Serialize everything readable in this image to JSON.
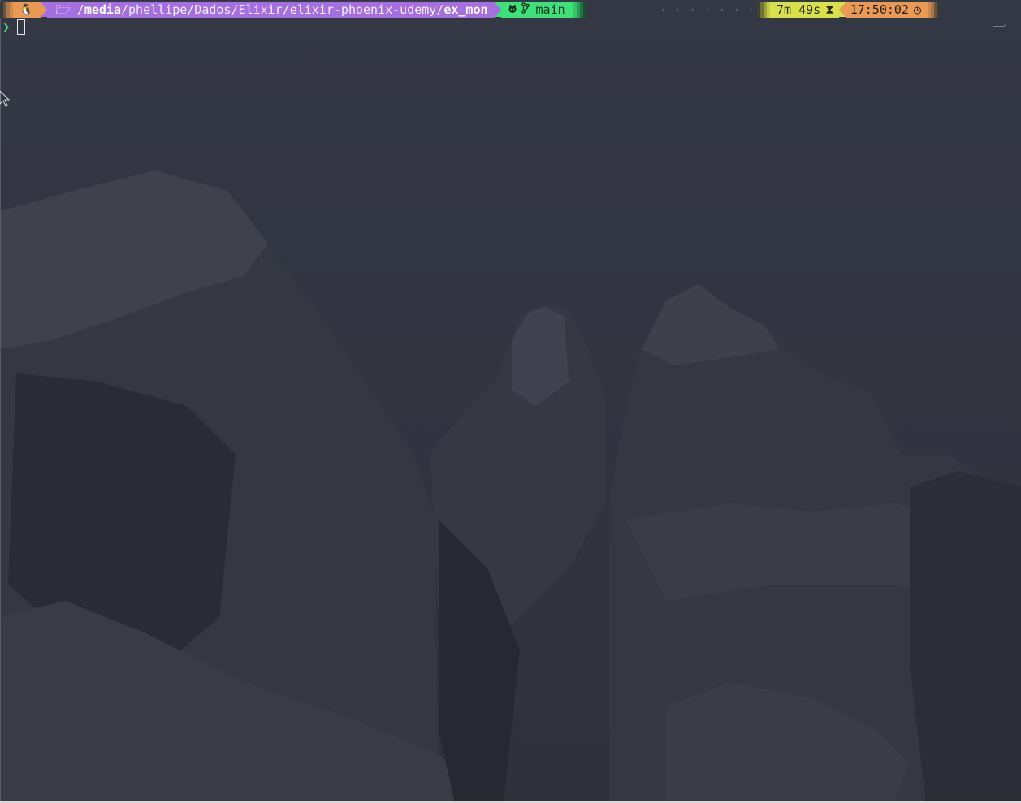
{
  "prompt": {
    "os_icon": "linux-tux-icon",
    "folder_icon": "folder-open-icon",
    "path_prefix": "/",
    "path_bold_start": "media",
    "path_middle": "/phellipe/Dados/Elixir/elixir-phoenix-udemy/",
    "path_bold_end": "ex_mon",
    "git_icon": "github-icon",
    "branch_icon": "git-branch-icon",
    "branch": "main",
    "filler": "· · · · · · · · · · · · · · · · · · · ·",
    "duration": "7m 49s",
    "duration_icon": "hourglass-icon",
    "time": "17:50:02",
    "time_icon": "clock-icon",
    "input_symbol": "❯"
  },
  "colors": {
    "os_segment": "#e89a55",
    "dir_segment": "#a66fe0",
    "git_segment": "#3ee07a",
    "duration_segment": "#d8e04a",
    "time_segment": "#e89a55",
    "background": "#30333f"
  },
  "glyphs": {
    "tux": "🐧",
    "folder": "🗁",
    "branch": "⎇",
    "hourglass": "⧗",
    "clock": "◷"
  }
}
